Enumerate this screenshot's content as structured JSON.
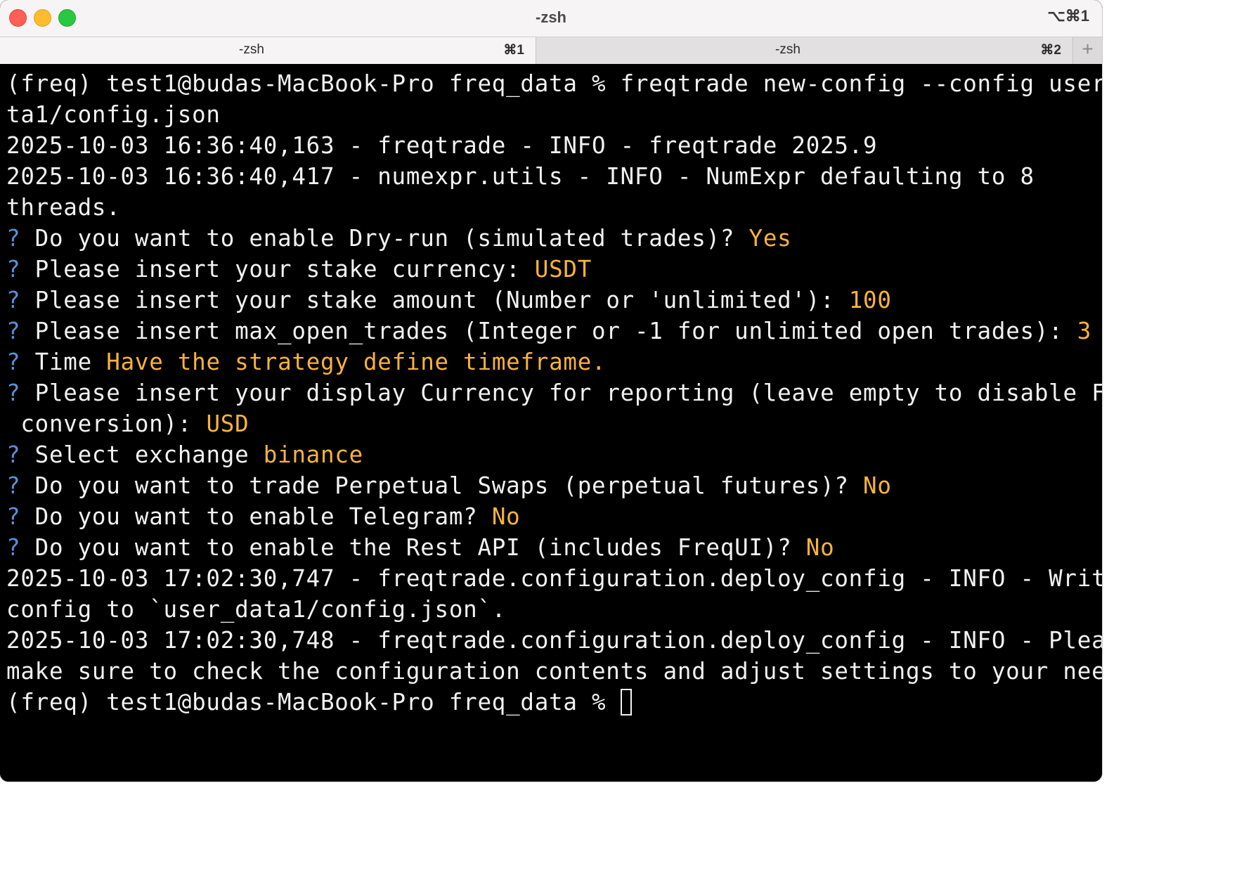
{
  "window": {
    "title": "-zsh",
    "shortcut": "⌥⌘1"
  },
  "tabs": [
    {
      "label": "-zsh",
      "shortcut": "⌘1",
      "active": true
    },
    {
      "label": "-zsh",
      "shortcut": "⌘2",
      "active": false
    }
  ],
  "new_tab_label": "+",
  "colors": {
    "prompt_marker": "#5a8fd6",
    "answer": "#f9b33c",
    "terminal_bg": "#000000",
    "terminal_fg": "#f2f2f2"
  },
  "terminal": {
    "command_line_1": "(freq) test1@budas-MacBook-Pro freq_data % freqtrade new-config --config user_da",
    "command_line_2": "ta1/config.json",
    "log_1": "2025-10-03 16:36:40,163 - freqtrade - INFO - freqtrade 2025.9",
    "log_2a": "2025-10-03 16:36:40,417 - numexpr.utils - INFO - NumExpr defaulting to 8",
    "log_2b": "threads.",
    "prompts": [
      {
        "marker": "?",
        "question": "Do you want to enable Dry-run (simulated trades)?",
        "answer": "Yes"
      },
      {
        "marker": "?",
        "question": "Please insert your stake currency:",
        "answer": "USDT"
      },
      {
        "marker": "?",
        "question": "Please insert your stake amount (Number or 'unlimited'):",
        "answer": "100"
      },
      {
        "marker": "?",
        "question": "Please insert max_open_trades (Integer or -1 for unlimited open trades):",
        "answer": "3"
      },
      {
        "marker": "?",
        "question": "Time",
        "answer": "Have the strategy define timeframe."
      },
      {
        "marker": "?",
        "question": "Please insert your display Currency for reporting (leave empty to disable FIAT",
        "question_cont": " conversion):",
        "answer": "USD"
      },
      {
        "marker": "?",
        "question": "Select exchange",
        "answer": "binance"
      },
      {
        "marker": "?",
        "question": "Do you want to trade Perpetual Swaps (perpetual futures)?",
        "answer": "No"
      },
      {
        "marker": "?",
        "question": "Do you want to enable Telegram?",
        "answer": "No"
      },
      {
        "marker": "?",
        "question": "Do you want to enable the Rest API (includes FreqUI)?",
        "answer": "No"
      }
    ],
    "log_3a": "2025-10-03 17:02:30,747 - freqtrade.configuration.deploy_config - INFO - Writing",
    "log_3b": "config to `user_data1/config.json`.",
    "log_4a": "2025-10-03 17:02:30,748 - freqtrade.configuration.deploy_config - INFO - Please",
    "log_4b": "make sure to check the configuration contents and adjust settings to your needs.",
    "final_prompt": "(freq) test1@budas-MacBook-Pro freq_data % "
  }
}
